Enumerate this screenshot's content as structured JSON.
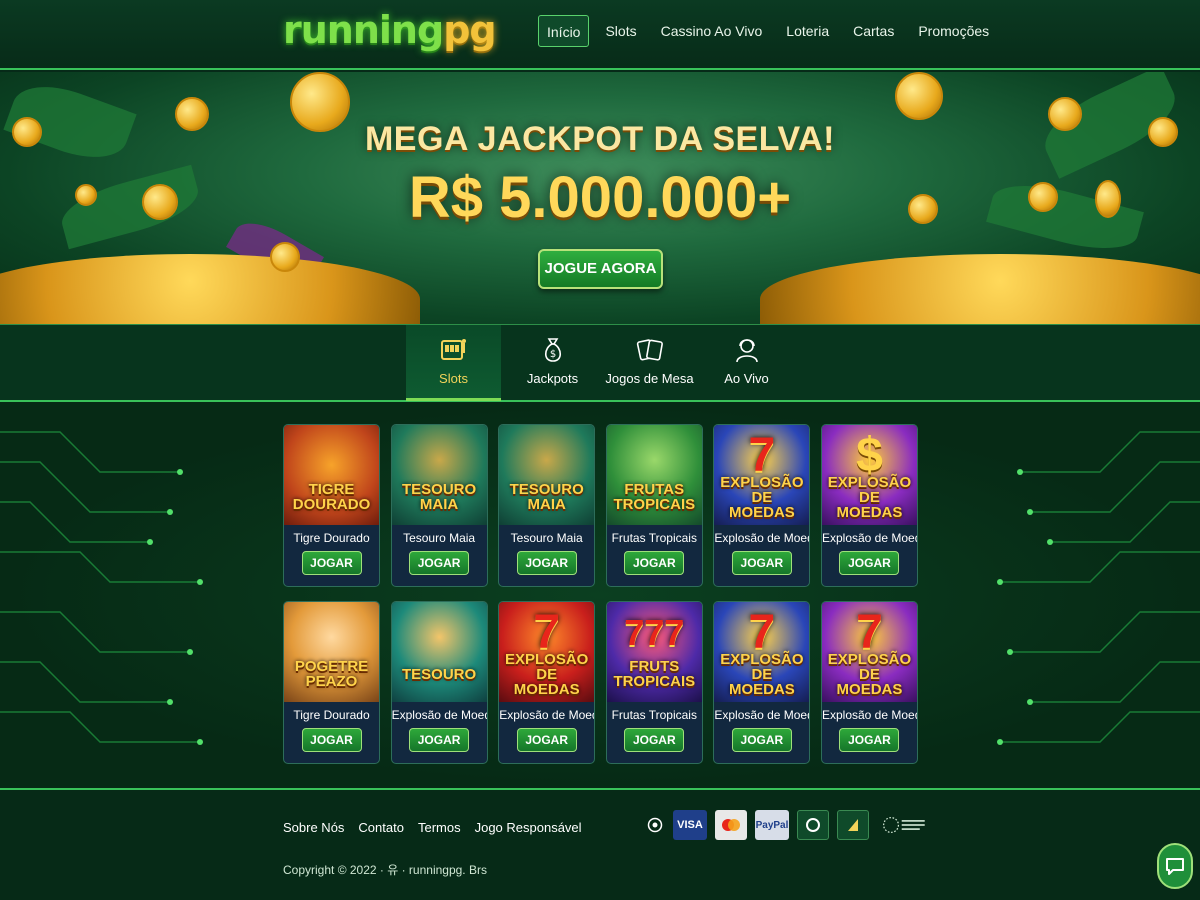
{
  "header": {
    "logo_main": "running",
    "logo_accent": "pg",
    "nav": [
      {
        "label": "Início",
        "active": true
      },
      {
        "label": "Slots",
        "active": false
      },
      {
        "label": "Cassino Ao Vivo",
        "active": false
      },
      {
        "label": "Loteria",
        "active": false
      },
      {
        "label": "Cartas",
        "active": false
      },
      {
        "label": "Promoções",
        "active": false
      }
    ]
  },
  "banner": {
    "title": "MEGA JACKPOT DA SELVA!",
    "amount": "R$ 5.000.000+",
    "cta_label": "JOGUE AGORA"
  },
  "categories": [
    {
      "label": "Slots",
      "icon": "slot-machine-icon",
      "active": true
    },
    {
      "label": "Jackpots",
      "icon": "money-bag-icon",
      "active": false
    },
    {
      "label": "Jogos de Mesa",
      "icon": "cards-icon",
      "active": false
    },
    {
      "label": "Ao Vivo",
      "icon": "live-dealer-icon",
      "active": false
    }
  ],
  "games": [
    {
      "art": "TIGRE DOURADO",
      "name": "Tigre Dourado",
      "play": "JOGAR"
    },
    {
      "art": "TESOURO MAIA",
      "name": "Tesouro Maia",
      "play": "JOGAR"
    },
    {
      "art": "TESOURO MAIA",
      "name": "Tesouro Maia",
      "play": "JOGAR"
    },
    {
      "art": "FRUTAS TROPICAIS",
      "name": "Frutas Tropicais",
      "play": "JOGAR"
    },
    {
      "art": "EXPLOSÃO DE MOEDAS",
      "name": "Explosão de Moedas",
      "play": "JOGAR"
    },
    {
      "art": "EXPLOSÃO DE MOEDAS",
      "name": "Explosão de Moedas",
      "play": "JOGAR"
    },
    {
      "art": "POGETRE PEAZO",
      "name": "Tigre Dourado",
      "play": "JOGAR"
    },
    {
      "art": "TESOURO",
      "name": "Explosão de Moedas",
      "play": "JOGAR"
    },
    {
      "art": "EXPLOSÃO DE MOEDAS",
      "name": "Explosão de Moedas",
      "play": "JOGAR"
    },
    {
      "art": "FRUTS TROPICAIS",
      "name": "Frutas Tropicais",
      "play": "JOGAR"
    },
    {
      "art": "EXPLOSÃO DE MOEDAS",
      "name": "Explosão de Moedas",
      "play": "JOGAR"
    },
    {
      "art": "EXPLOSÃO DE MOEDAS",
      "name": "Explosão de Moedas",
      "play": "JOGAR"
    }
  ],
  "footer": {
    "links": [
      "Sobre Nós",
      "Contato",
      "Termos",
      "Jogo Responsável"
    ],
    "payments": [
      "VISA",
      "PayPal"
    ],
    "copyright": "Copyright © 2022 · 유 · runningpg. Brs"
  },
  "colors": {
    "accent_green": "#39c25a",
    "gold": "#ffd85a",
    "background": "#062a18"
  }
}
